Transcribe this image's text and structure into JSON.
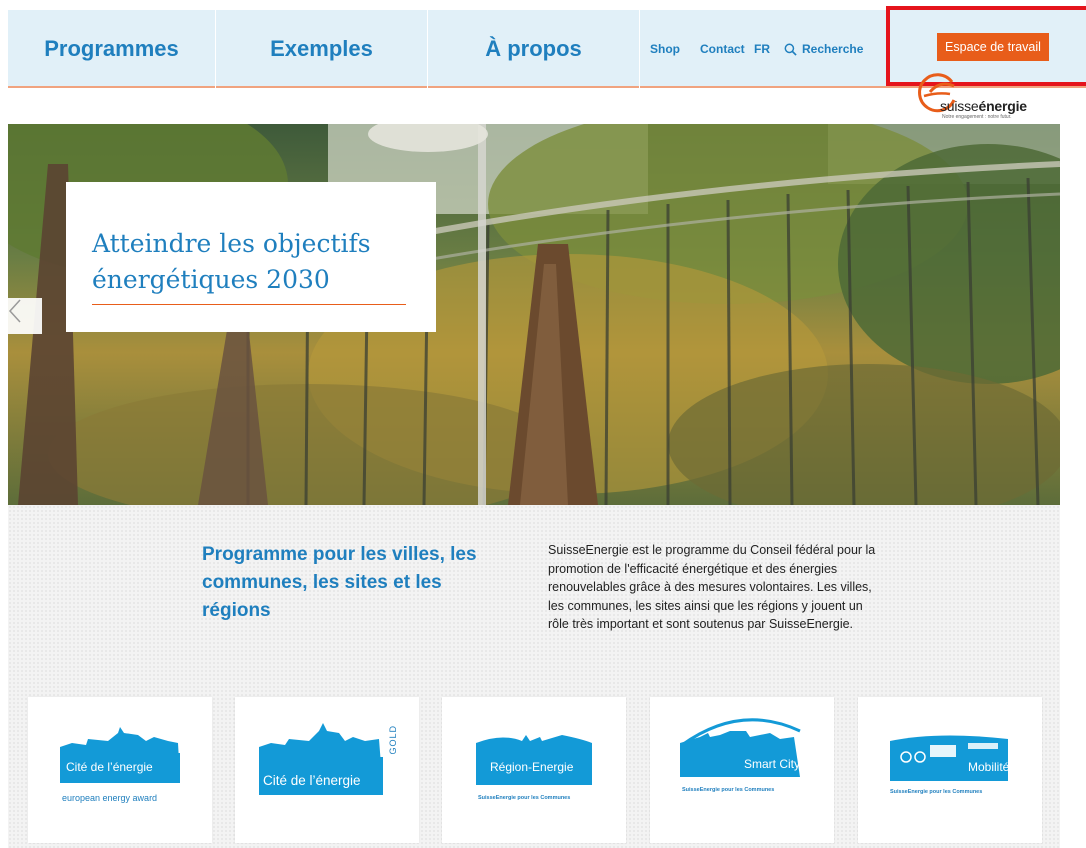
{
  "nav": {
    "programmes": "Programmes",
    "exemples": "Exemples",
    "apropos": "À propos",
    "shop": "Shop",
    "contact": "Contact",
    "language": "FR",
    "search": "Recherche",
    "workspace": "Espace de travail"
  },
  "logo": {
    "brand_light": "suisse",
    "brand_bold": "énergie",
    "tagline": "Notre engagement : notre futur."
  },
  "hero": {
    "title": "Atteindre les objectifs énergétiques 2030"
  },
  "intro": {
    "heading": "Programme pour les villes, les communes, les sites et les régions",
    "text": "SuisseEnergie est le programme du Conseil fédéral pour la promotion de l'efficacité énergétique et des énergies renouvelables grâce à des mesures volontaires. Les villes, les communes, les sites ainsi que les régions y jouent un rôle très important et sont soutenus par SuisseEnergie."
  },
  "tiles": [
    {
      "label": "Cité de l’énergie",
      "sub": "european energy award"
    },
    {
      "label": "Cité de l’énergie",
      "badge": "GOLD"
    },
    {
      "label": "Région-Energie",
      "sub": "SuisseEnergie pour les Communes"
    },
    {
      "label": "Smart City",
      "sub": "SuisseEnergie pour les Communes"
    },
    {
      "label": "Mobilité",
      "sub": "SuisseEnergie pour les Communes"
    }
  ],
  "colors": {
    "brand_blue": "#1f7fbe",
    "accent_orange": "#e85d1a",
    "nav_bg": "#e1f0f8",
    "highlight_red": "#e5141c",
    "tile_blue": "#139ad7"
  },
  "icons": {
    "search": "search-icon",
    "prev": "chevron-left-icon"
  }
}
